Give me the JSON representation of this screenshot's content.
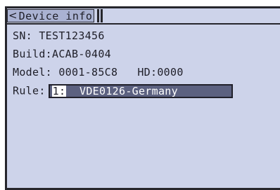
{
  "title_bar": {
    "back_icon": "<",
    "title": "Device info"
  },
  "fields": {
    "sn_label": "SN:",
    "sn_value": "TEST123456",
    "build_label": "Build:",
    "build_value": "ACAB-0404",
    "model_label": "Model:",
    "model_value": "0001-85C8",
    "hd_label": "HD:",
    "hd_value": "0000",
    "rule_label": "Rule:",
    "rule_index": "1:",
    "rule_value": "VDE0126-Germany"
  },
  "colors": {
    "screen_bg": "#cdd3ea",
    "title_bg": "#aab2d2",
    "selection_bg": "#5c6180",
    "text": "#20202a"
  }
}
